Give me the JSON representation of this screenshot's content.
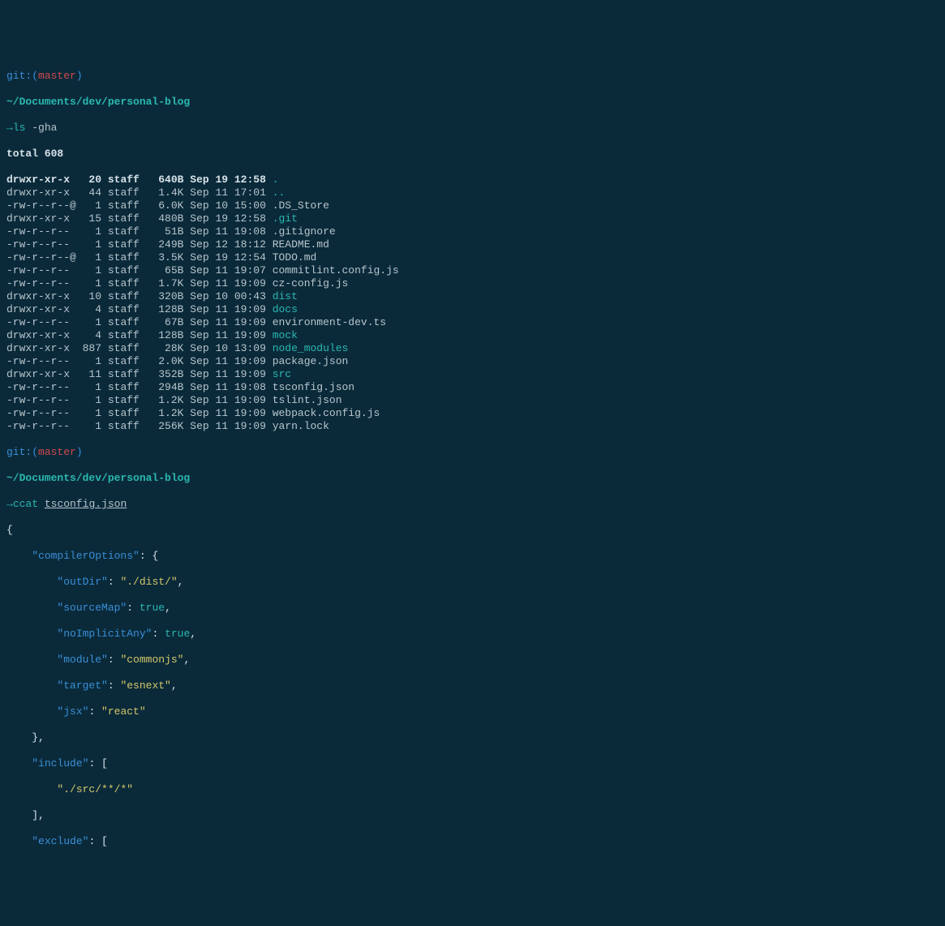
{
  "prompt1": {
    "git": "git:",
    "lp": "(",
    "branch": "master",
    "rp": ")"
  },
  "cwd": "~/Documents/dev/personal-blog",
  "cmd1": {
    "arrow": "→",
    "name": "ls",
    "args": " -gha"
  },
  "total": "total 608",
  "files": [
    {
      "perm": "drwxr-xr-x ",
      "links": "  20",
      "grp": " staff ",
      "size": "  640B",
      "date": " Sep 19 12:58 ",
      "name": ".",
      "dir": true,
      "bold": true
    },
    {
      "perm": "drwxr-xr-x ",
      "links": "  44",
      "grp": " staff ",
      "size": "  1.4K",
      "date": " Sep 11 17:01 ",
      "name": "..",
      "dir": true,
      "bold": false
    },
    {
      "perm": "-rw-r--r--@",
      "links": "   1",
      "grp": " staff ",
      "size": "  6.0K",
      "date": " Sep 10 15:00 ",
      "name": ".DS_Store",
      "dir": false,
      "bold": false
    },
    {
      "perm": "drwxr-xr-x ",
      "links": "  15",
      "grp": " staff ",
      "size": "  480B",
      "date": " Sep 19 12:58 ",
      "name": ".git",
      "dir": true,
      "bold": false
    },
    {
      "perm": "-rw-r--r-- ",
      "links": "   1",
      "grp": " staff ",
      "size": "   51B",
      "date": " Sep 11 19:08 ",
      "name": ".gitignore",
      "dir": false,
      "bold": false
    },
    {
      "perm": "-rw-r--r-- ",
      "links": "   1",
      "grp": " staff ",
      "size": "  249B",
      "date": " Sep 12 18:12 ",
      "name": "README.md",
      "dir": false,
      "bold": false
    },
    {
      "perm": "-rw-r--r--@",
      "links": "   1",
      "grp": " staff ",
      "size": "  3.5K",
      "date": " Sep 19 12:54 ",
      "name": "TODO.md",
      "dir": false,
      "bold": false
    },
    {
      "perm": "-rw-r--r-- ",
      "links": "   1",
      "grp": " staff ",
      "size": "   65B",
      "date": " Sep 11 19:07 ",
      "name": "commitlint.config.js",
      "dir": false,
      "bold": false
    },
    {
      "perm": "-rw-r--r-- ",
      "links": "   1",
      "grp": " staff ",
      "size": "  1.7K",
      "date": " Sep 11 19:09 ",
      "name": "cz-config.js",
      "dir": false,
      "bold": false
    },
    {
      "perm": "drwxr-xr-x ",
      "links": "  10",
      "grp": " staff ",
      "size": "  320B",
      "date": " Sep 10 00:43 ",
      "name": "dist",
      "dir": true,
      "bold": false
    },
    {
      "perm": "drwxr-xr-x ",
      "links": "   4",
      "grp": " staff ",
      "size": "  128B",
      "date": " Sep 11 19:09 ",
      "name": "docs",
      "dir": true,
      "bold": false
    },
    {
      "perm": "-rw-r--r-- ",
      "links": "   1",
      "grp": " staff ",
      "size": "   67B",
      "date": " Sep 11 19:09 ",
      "name": "environment-dev.ts",
      "dir": false,
      "bold": false
    },
    {
      "perm": "drwxr-xr-x ",
      "links": "   4",
      "grp": " staff ",
      "size": "  128B",
      "date": " Sep 11 19:09 ",
      "name": "mock",
      "dir": true,
      "bold": false
    },
    {
      "perm": "drwxr-xr-x ",
      "links": " 887",
      "grp": " staff ",
      "size": "   28K",
      "date": " Sep 10 13:09 ",
      "name": "node_modules",
      "dir": true,
      "bold": false
    },
    {
      "perm": "-rw-r--r-- ",
      "links": "   1",
      "grp": " staff ",
      "size": "  2.0K",
      "date": " Sep 11 19:09 ",
      "name": "package.json",
      "dir": false,
      "bold": false
    },
    {
      "perm": "drwxr-xr-x ",
      "links": "  11",
      "grp": " staff ",
      "size": "  352B",
      "date": " Sep 11 19:09 ",
      "name": "src",
      "dir": true,
      "bold": false
    },
    {
      "perm": "-rw-r--r-- ",
      "links": "   1",
      "grp": " staff ",
      "size": "  294B",
      "date": " Sep 11 19:08 ",
      "name": "tsconfig.json",
      "dir": false,
      "bold": false
    },
    {
      "perm": "-rw-r--r-- ",
      "links": "   1",
      "grp": " staff ",
      "size": "  1.2K",
      "date": " Sep 11 19:09 ",
      "name": "tslint.json",
      "dir": false,
      "bold": false
    },
    {
      "perm": "-rw-r--r-- ",
      "links": "   1",
      "grp": " staff ",
      "size": "  1.2K",
      "date": " Sep 11 19:09 ",
      "name": "webpack.config.js",
      "dir": false,
      "bold": false
    },
    {
      "perm": "-rw-r--r-- ",
      "links": "   1",
      "grp": " staff ",
      "size": "  256K",
      "date": " Sep 11 19:09 ",
      "name": "yarn.lock",
      "dir": false,
      "bold": false
    }
  ],
  "cmd2": {
    "arrow": "→",
    "name": "ccat",
    "arg": "tsconfig.json"
  },
  "json": {
    "l0": "{",
    "l1a": "    ",
    "l1k": "\"compilerOptions\"",
    "l1c": ": {",
    "l2a": "        ",
    "l2k": "\"outDir\"",
    "l2c": ": ",
    "l2v": "\"./dist/\"",
    "l2e": ",",
    "l3a": "        ",
    "l3k": "\"sourceMap\"",
    "l3c": ": ",
    "l3v": "true",
    "l3e": ",",
    "l4a": "        ",
    "l4k": "\"noImplicitAny\"",
    "l4c": ": ",
    "l4v": "true",
    "l4e": ",",
    "l5a": "        ",
    "l5k": "\"module\"",
    "l5c": ": ",
    "l5v": "\"commonjs\"",
    "l5e": ",",
    "l6a": "        ",
    "l6k": "\"target\"",
    "l6c": ": ",
    "l6v": "\"esnext\"",
    "l6e": ",",
    "l7a": "        ",
    "l7k": "\"jsx\"",
    "l7c": ": ",
    "l7v": "\"react\"",
    "l8": "    },",
    "l9a": "    ",
    "l9k": "\"include\"",
    "l9c": ": [",
    "l10a": "        ",
    "l10v": "\"./src/**/*\"",
    "l11": "    ],",
    "l12a": "    ",
    "l12k": "\"exclude\"",
    "l12c": ": ["
  }
}
